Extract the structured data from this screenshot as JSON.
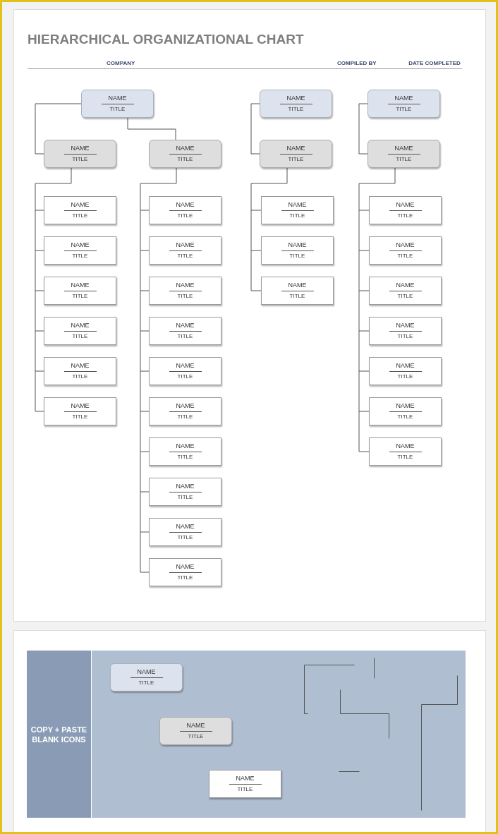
{
  "document": {
    "title": "HIERARCHICAL ORGANIZATIONAL CHART",
    "header_fields": [
      {
        "label": "COMPANY"
      },
      {
        "label": "COMPILED BY"
      },
      {
        "label": "DATE COMPLETED"
      }
    ],
    "charts": [
      {
        "kind": "top",
        "name": "NAME",
        "title": "TITLE",
        "children": [
          {
            "kind": "mid",
            "name": "NAME",
            "title": "TITLE",
            "children": [
              {
                "kind": "leaf",
                "name": "NAME",
                "title": "TITLE"
              },
              {
                "kind": "leaf",
                "name": "NAME",
                "title": "TITLE"
              },
              {
                "kind": "leaf",
                "name": "NAME",
                "title": "TITLE"
              },
              {
                "kind": "leaf",
                "name": "NAME",
                "title": "TITLE"
              },
              {
                "kind": "leaf",
                "name": "NAME",
                "title": "TITLE"
              },
              {
                "kind": "leaf",
                "name": "NAME",
                "title": "TITLE"
              }
            ]
          },
          {
            "kind": "mid",
            "name": "NAME",
            "title": "TITLE",
            "children": [
              {
                "kind": "leaf",
                "name": "NAME",
                "title": "TITLE"
              },
              {
                "kind": "leaf",
                "name": "NAME",
                "title": "TITLE"
              },
              {
                "kind": "leaf",
                "name": "NAME",
                "title": "TITLE"
              },
              {
                "kind": "leaf",
                "name": "NAME",
                "title": "TITLE"
              },
              {
                "kind": "leaf",
                "name": "NAME",
                "title": "TITLE"
              },
              {
                "kind": "leaf",
                "name": "NAME",
                "title": "TITLE"
              },
              {
                "kind": "leaf",
                "name": "NAME",
                "title": "TITLE"
              },
              {
                "kind": "leaf",
                "name": "NAME",
                "title": "TITLE"
              },
              {
                "kind": "leaf",
                "name": "NAME",
                "title": "TITLE"
              },
              {
                "kind": "leaf",
                "name": "NAME",
                "title": "TITLE"
              }
            ]
          }
        ]
      },
      {
        "kind": "top",
        "name": "NAME",
        "title": "TITLE",
        "children": [
          {
            "kind": "mid",
            "name": "NAME",
            "title": "TITLE",
            "children": [
              {
                "kind": "leaf",
                "name": "NAME",
                "title": "TITLE"
              },
              {
                "kind": "leaf",
                "name": "NAME",
                "title": "TITLE"
              },
              {
                "kind": "leaf",
                "name": "NAME",
                "title": "TITLE"
              }
            ]
          }
        ]
      },
      {
        "kind": "top",
        "name": "NAME",
        "title": "TITLE",
        "children": [
          {
            "kind": "mid",
            "name": "NAME",
            "title": "TITLE",
            "children": [
              {
                "kind": "leaf",
                "name": "NAME",
                "title": "TITLE"
              },
              {
                "kind": "leaf",
                "name": "NAME",
                "title": "TITLE"
              },
              {
                "kind": "leaf",
                "name": "NAME",
                "title": "TITLE"
              },
              {
                "kind": "leaf",
                "name": "NAME",
                "title": "TITLE"
              },
              {
                "kind": "leaf",
                "name": "NAME",
                "title": "TITLE"
              },
              {
                "kind": "leaf",
                "name": "NAME",
                "title": "TITLE"
              },
              {
                "kind": "leaf",
                "name": "NAME",
                "title": "TITLE"
              }
            ]
          }
        ]
      }
    ]
  },
  "icons_panel": {
    "label": "COPY + PASTE BLANK ICONS",
    "samples": [
      {
        "kind": "top",
        "name": "NAME",
        "title": "TITLE"
      },
      {
        "kind": "mid",
        "name": "NAME",
        "title": "TITLE"
      },
      {
        "kind": "leaf",
        "name": "NAME",
        "title": "TITLE"
      }
    ]
  }
}
